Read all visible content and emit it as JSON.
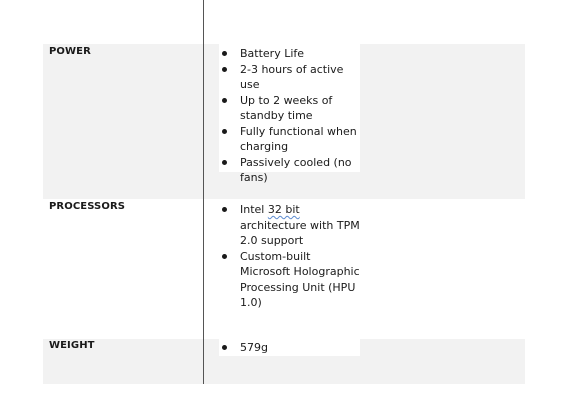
{
  "rows": [
    {
      "label": "POWER",
      "items": [
        "Battery Life",
        "2-3 hours of active use",
        "Up to 2 weeks of standby time",
        "Fully functional when charging",
        "Passively cooled (no fans)"
      ]
    },
    {
      "label": "PROCESSORS",
      "items": [
        {
          "pre": "Intel ",
          "flagged": "32 bit",
          "post": " architecture with TPM 2.0 support"
        },
        "Custom-built Microsoft Holographic Processing Unit (HPU 1.0)"
      ]
    },
    {
      "label": "WEIGHT",
      "items": [
        "579g"
      ]
    }
  ]
}
